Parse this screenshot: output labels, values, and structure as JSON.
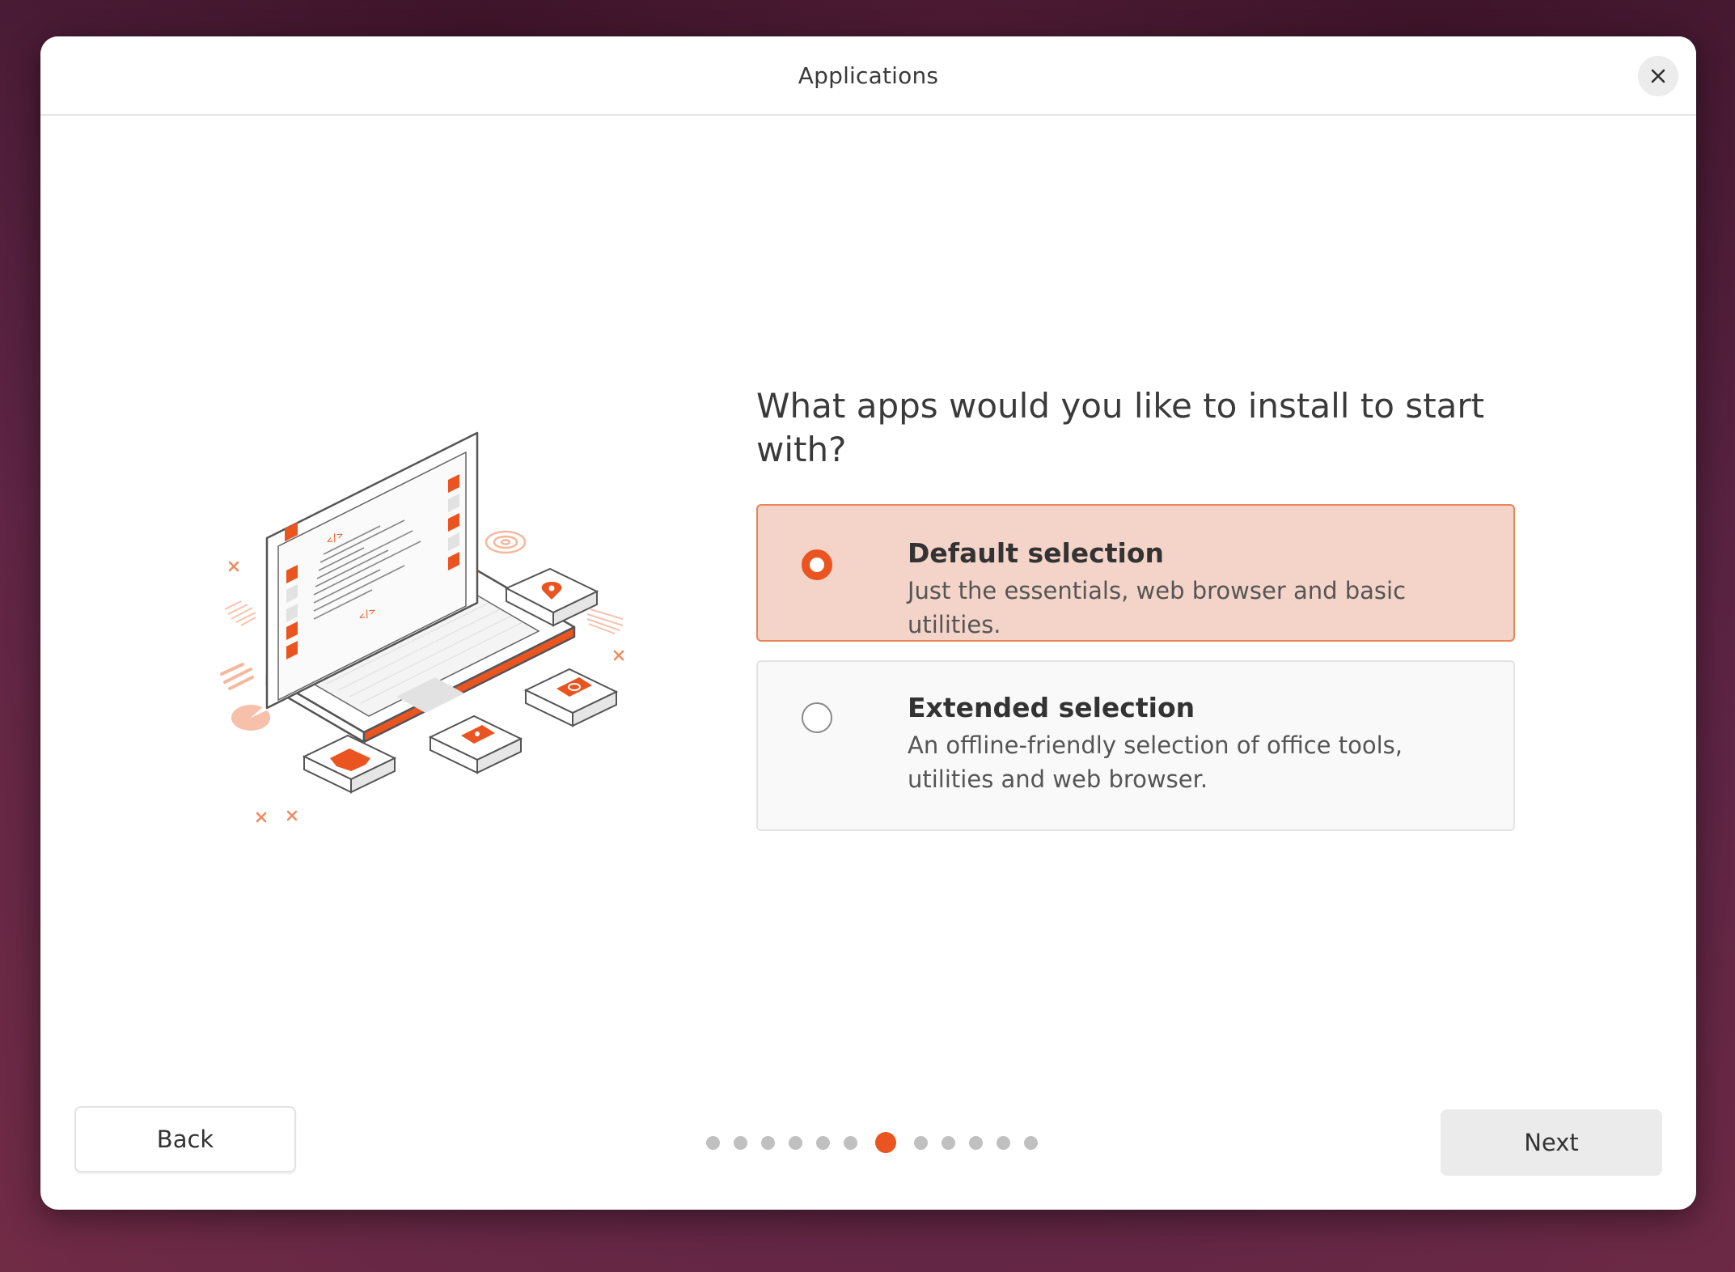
{
  "window": {
    "title": "Applications",
    "close_icon": "close-icon"
  },
  "main": {
    "question": "What apps would you like to install to start with?",
    "options": [
      {
        "title": "Default selection",
        "description": "Just the essentials, web browser and basic utilities.",
        "selected": true
      },
      {
        "title": "Extended selection",
        "description": "An offline-friendly selection of office tools, utilities and web browser.",
        "selected": false
      }
    ],
    "illustration": "laptop-with-app-icons-illustration"
  },
  "footer": {
    "back_label": "Back",
    "next_label": "Next",
    "progress": {
      "total_steps": 12,
      "current_step": 7
    }
  },
  "colors": {
    "accent": "#e95420",
    "selected_card_bg": "#f4d4c8",
    "selected_card_border": "#e9855a",
    "unselected_card_bg": "#f9f9f9",
    "dot_inactive": "#c0c0c0",
    "desktop_bg": "#5a2040"
  }
}
